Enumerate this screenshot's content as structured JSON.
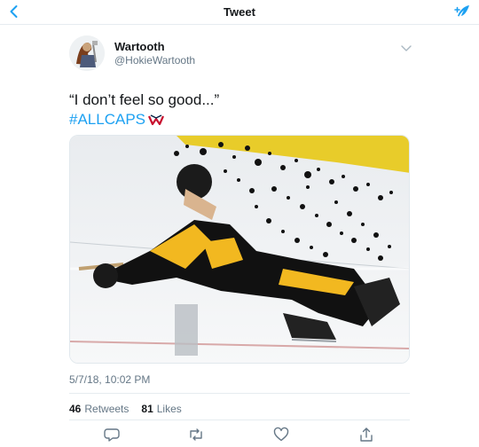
{
  "colors": {
    "link": "#1da1f2",
    "secondary_text": "#657786",
    "primary_text": "#14171a"
  },
  "nav": {
    "title": "Tweet",
    "back_icon": "chevron-left-icon",
    "compose_icon": "compose-feather-icon"
  },
  "author": {
    "display_name": "Wartooth",
    "handle": "@HokieWartooth"
  },
  "tweet": {
    "text": "“I don’t feel so good...”",
    "hashtag": "#ALLCAPS",
    "timestamp": "5/7/18, 10:02 PM"
  },
  "stats": {
    "retweets_count": "46",
    "retweets_label": "Retweets",
    "likes_count": "81",
    "likes_label": "Likes"
  },
  "actions": [
    "reply-icon",
    "retweet-icon",
    "like-icon",
    "share-icon"
  ]
}
